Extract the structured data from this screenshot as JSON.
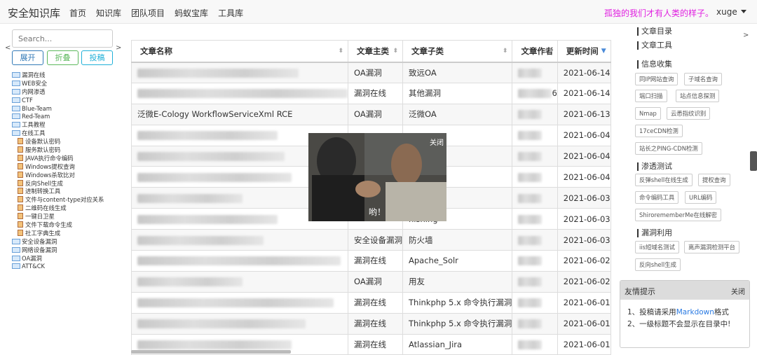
{
  "nav": {
    "brand": "安全知识库",
    "links": [
      "首页",
      "知识库",
      "团队项目",
      "蚂蚁宝库",
      "工具库"
    ],
    "slogan": "孤独的我们才有人类的样子。",
    "user": "xuge"
  },
  "left": {
    "search_placeholder": "Search...",
    "expand_label": "展开",
    "collapse_label": "折叠",
    "submit_label": "投稿",
    "tree": [
      {
        "label": "漏洞在线",
        "type": "folder",
        "level": 0
      },
      {
        "label": "WEB安全",
        "type": "folder",
        "level": 0
      },
      {
        "label": "内网渗透",
        "type": "folder",
        "level": 0
      },
      {
        "label": "CTF",
        "type": "folder",
        "level": 0
      },
      {
        "label": "Blue-Team",
        "type": "folder",
        "level": 0
      },
      {
        "label": "Red-Team",
        "type": "folder",
        "level": 0
      },
      {
        "label": "工具教程",
        "type": "folder",
        "level": 0
      },
      {
        "label": "在线工具",
        "type": "folder-open",
        "level": 0
      },
      {
        "label": "设备默认密码",
        "type": "file",
        "level": 1
      },
      {
        "label": "服务默认密码",
        "type": "file",
        "level": 1
      },
      {
        "label": "JAVA执行命令编码",
        "type": "file",
        "level": 1
      },
      {
        "label": "Windows提权查询",
        "type": "file",
        "level": 1
      },
      {
        "label": "Windows杀软比对",
        "type": "file",
        "level": 1
      },
      {
        "label": "反向Shell生成",
        "type": "file",
        "level": 1
      },
      {
        "label": "进制转换工具",
        "type": "file",
        "level": 1
      },
      {
        "label": "文件与content-type对应关系",
        "type": "file",
        "level": 1
      },
      {
        "label": "二维码在线生成",
        "type": "file",
        "level": 1
      },
      {
        "label": "一键日卫星",
        "type": "file",
        "level": 1
      },
      {
        "label": "文件下载命令生成",
        "type": "file",
        "level": 1
      },
      {
        "label": "社工字典生成",
        "type": "file",
        "level": 1
      },
      {
        "label": "安全设备漏洞",
        "type": "folder",
        "level": 0
      },
      {
        "label": "网络设备漏洞",
        "type": "folder",
        "level": 0
      },
      {
        "label": "OA漏洞",
        "type": "folder",
        "level": 0
      },
      {
        "label": "ATT&CK",
        "type": "folder",
        "level": 0
      }
    ]
  },
  "table": {
    "headers": [
      "文章名称",
      "文章主类",
      "文章子类",
      "文章作者",
      "更新时间"
    ],
    "rows": [
      {
        "name": "",
        "main": "OA漏洞",
        "sub": "致远OA",
        "author": "",
        "date": "2021-06-14"
      },
      {
        "name": "",
        "main": "漏洞在线",
        "sub": "其他漏洞",
        "author": "6",
        "date": "2021-06-14"
      },
      {
        "name": "泛微E-Cology WorkflowServiceXml RCE",
        "main": "OA漏洞",
        "sub": "泛微OA",
        "author": "",
        "date": "2021-06-13"
      },
      {
        "name": "",
        "main": "",
        "sub": "",
        "author": "",
        "date": "2021-06-04"
      },
      {
        "name": "",
        "main": "",
        "sub": "",
        "author": "",
        "date": "2021-06-04"
      },
      {
        "name": "",
        "main": "",
        "sub": "",
        "author": "",
        "date": "2021-06-04"
      },
      {
        "name": "",
        "main": "",
        "sub": "",
        "author": "",
        "date": "2021-06-03"
      },
      {
        "name": "",
        "main": "",
        "sub": "hishing",
        "author": "",
        "date": "2021-06-03"
      },
      {
        "name": "",
        "main": "安全设备漏洞",
        "sub": "防火墙",
        "author": "",
        "date": "2021-06-03"
      },
      {
        "name": "",
        "main": "漏洞在线",
        "sub": "Apache_Solr",
        "author": "",
        "date": "2021-06-02"
      },
      {
        "name": "",
        "main": "OA漏洞",
        "sub": "用友",
        "author": "",
        "date": "2021-06-02"
      },
      {
        "name": "",
        "main": "漏洞在线",
        "sub": "Thinkphp 5.x 命令执行漏洞",
        "author": "",
        "date": "2021-06-01"
      },
      {
        "name": "",
        "main": "漏洞在线",
        "sub": "Thinkphp 5.x 命令执行漏洞",
        "author": "",
        "date": "2021-06-01"
      },
      {
        "name": "",
        "main": "漏洞在线",
        "sub": "Atlassian_Jira",
        "author": "",
        "date": "2021-06-01"
      }
    ]
  },
  "right": {
    "top_links": [
      "文章目录",
      "文章工具"
    ],
    "sections": [
      {
        "title": "信息收集",
        "tags": [
          "同IP网站查询",
          "子域名查询",
          "端口扫描",
          "站点信息探测",
          "Nmap",
          "云悉指纹识别",
          "17ceCDN检测",
          "站长之PING-CDN检测"
        ]
      },
      {
        "title": "渗透测试",
        "tags": [
          "反弹shell在线生成",
          "提权查询",
          "命令编码工具",
          "URL编码",
          "ShirorememberMe在线解密"
        ]
      },
      {
        "title": "漏洞利用",
        "tags": [
          "iis短域名测试",
          "离声漏洞检测平台",
          "反向shell生成"
        ]
      }
    ]
  },
  "popup": {
    "close_label": "关闭",
    "caption": "哟！"
  },
  "notice": {
    "title": "友情提示",
    "close_label": "关闭",
    "line1_prefix": "1、投稿请采用",
    "line1_link": "Markdown",
    "line1_suffix": "格式",
    "line2": "2、一级标题不会显示在目录中!"
  }
}
